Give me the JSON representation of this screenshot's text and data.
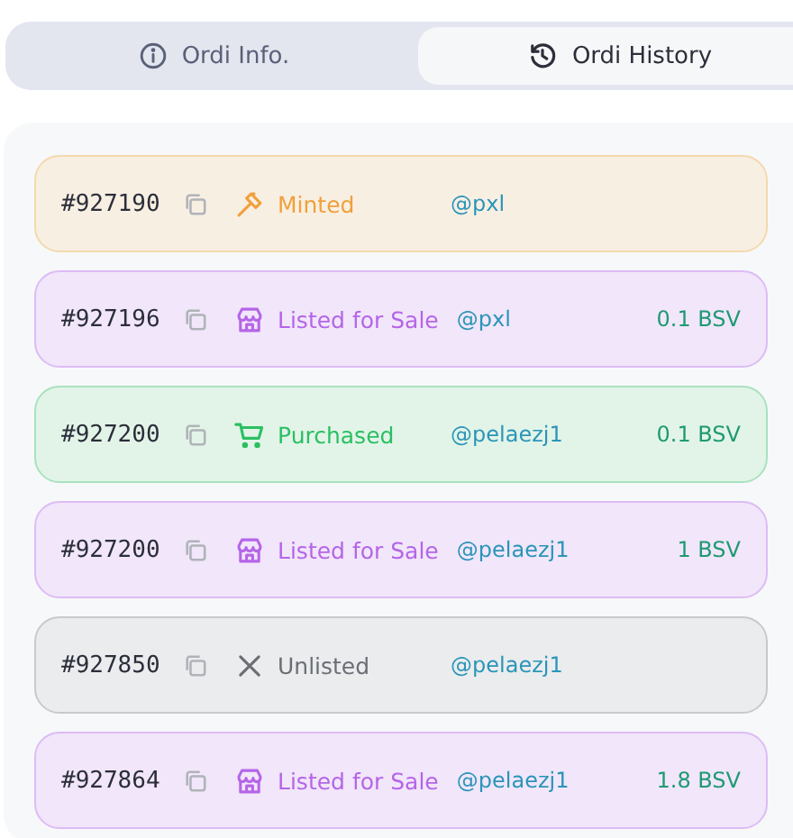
{
  "tabs": [
    {
      "label": "Ordi Info.",
      "kind": "info",
      "selected": false
    },
    {
      "label": "Ordi History",
      "kind": "history",
      "selected": true
    }
  ],
  "history": [
    {
      "id": "#927190",
      "kind": "minted",
      "event": "Minted",
      "user": "@pxl"
    },
    {
      "id": "#927196",
      "kind": "listed",
      "event": "Listed for Sale",
      "user": "@pxl",
      "price": "0.1 BSV"
    },
    {
      "id": "#927200",
      "kind": "purchased",
      "event": "Purchased",
      "user": "@pelaezj1",
      "price": "0.1 BSV"
    },
    {
      "id": "#927200",
      "kind": "listed",
      "event": "Listed for Sale",
      "user": "@pelaezj1",
      "price": "1 BSV"
    },
    {
      "id": "#927850",
      "kind": "unlisted",
      "event": "Unlisted",
      "user": "@pelaezj1"
    },
    {
      "id": "#927864",
      "kind": "listed",
      "event": "Listed for Sale",
      "user": "@pelaezj1",
      "price": "1.8 BSV"
    }
  ]
}
